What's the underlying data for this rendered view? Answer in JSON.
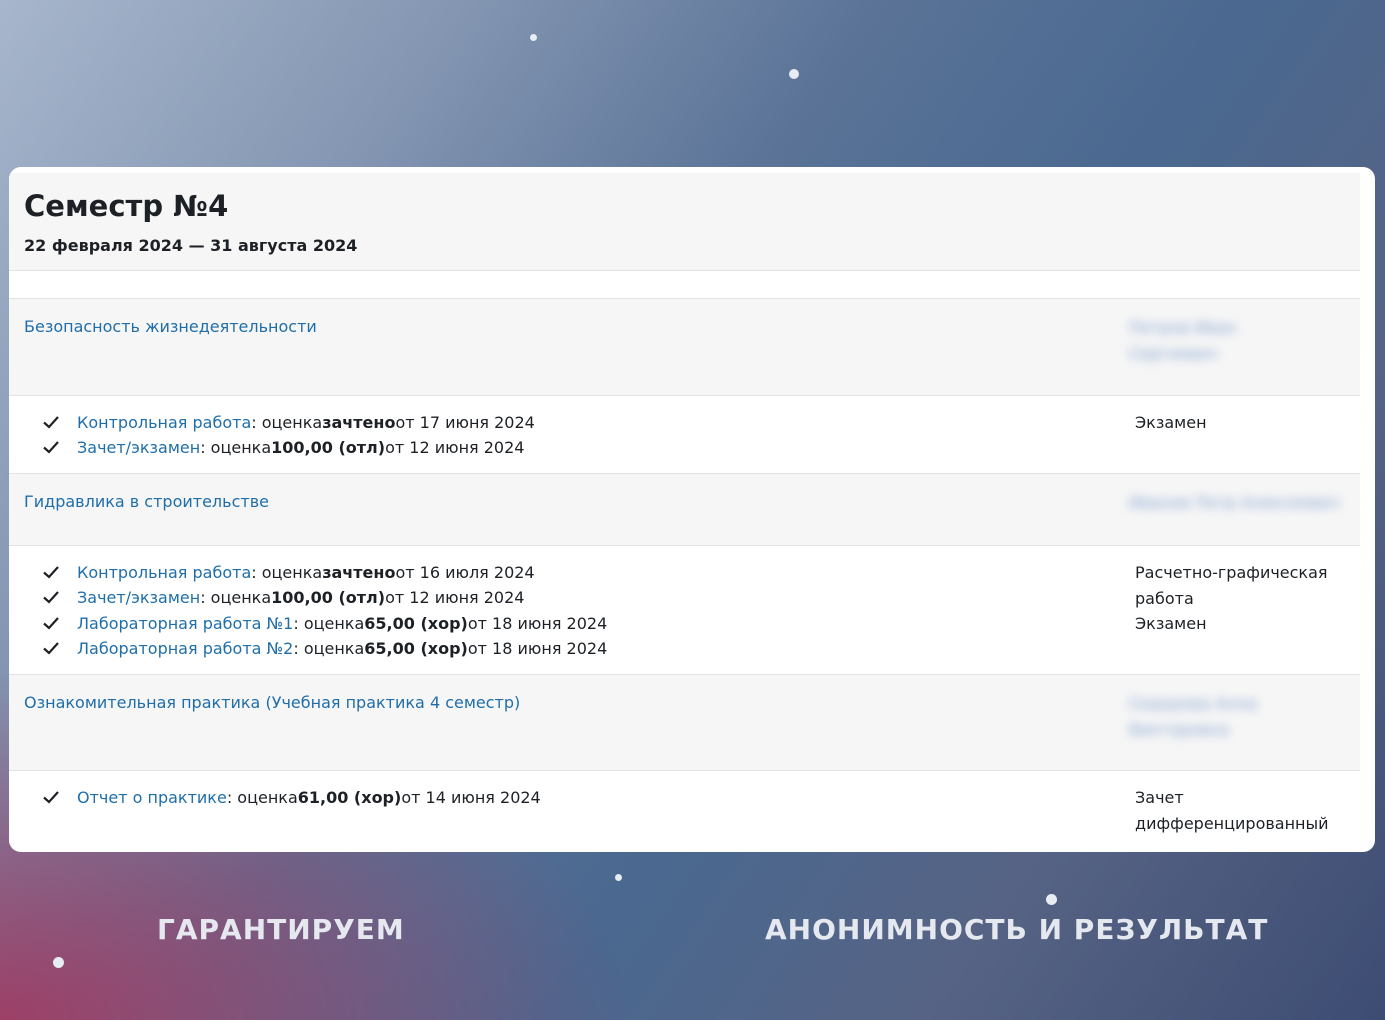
{
  "semester": {
    "title": "Семестр №4",
    "dates": "22 февраля 2024 — 31 августа 2024"
  },
  "courses": [
    {
      "name": "Безопасность жизнедеятельности",
      "teacher": "Петров Иван Сергеевич",
      "items": [
        {
          "name": "Контрольная работа",
          "pre": " : оценка ",
          "grade": "зачтено",
          "post": " от 17 июня 2024"
        },
        {
          "name": "Зачет/экзамен",
          "pre": " : оценка ",
          "grade": "100,00 (отл)",
          "post": " от 12 июня 2024"
        }
      ],
      "control_type": "Экзамен"
    },
    {
      "name": "Гидравлика в строительстве",
      "teacher": "Иванов Петр Алексеевич",
      "items": [
        {
          "name": "Контрольная работа",
          "pre": " : оценка ",
          "grade": "зачтено",
          "post": " от 16 июля 2024"
        },
        {
          "name": "Зачет/экзамен",
          "pre": " : оценка ",
          "grade": "100,00 (отл)",
          "post": " от 12 июня 2024"
        },
        {
          "name": "Лабораторная работа №1",
          "pre": " : оценка ",
          "grade": "65,00 (хор)",
          "post": " от 18 июня 2024"
        },
        {
          "name": "Лабораторная работа №2",
          "pre": " : оценка ",
          "grade": "65,00 (хор)",
          "post": " от 18 июня 2024"
        }
      ],
      "control_type_lines": [
        "Расчетно-графическая",
        "работа",
        "Экзамен"
      ]
    },
    {
      "name": "Ознакомительная практика (Учебная практика 4 семестр)",
      "teacher": "Сидорова Анна Викторовна",
      "items": [
        {
          "name": "Отчет о практике",
          "pre": " : оценка ",
          "grade": "61,00 (хор)",
          "post": " от 14 июня 2024"
        }
      ],
      "control_type_lines": [
        "Зачет",
        "дифференцированный"
      ]
    }
  ],
  "footer": {
    "left": "ГАРАНТИРУЕМ",
    "right": "АНОНИМНОСТЬ И РЕЗУЛЬТАТ"
  }
}
